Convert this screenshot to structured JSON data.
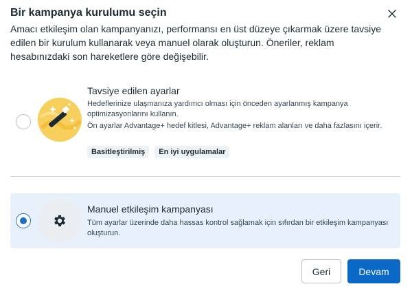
{
  "dialog": {
    "title": "Bir kampanya kurulumu seçin",
    "description": "Amacı etkileşim olan kampanyanızı, performansı en üst düzeye çıkarmak üzere tavsiye edilen bir kurulum kullanarak veya manuel olarak oluşturun. Öneriler, reklam hesabınızdaki son hareketlere göre değişebilir.",
    "close_icon": "close-icon"
  },
  "options": [
    {
      "title": "Tavsiye edilen ayarlar",
      "description_1": "Hedeflerinize ulaşmanıza yardımcı olması için önceden ayarlanmış kampanya optimizasyonlarını kullanın.",
      "description_2": "Ön ayarlar Advantage+ hedef kitlesi, Advantage+ reklam alanları ve daha fazlasını içerir.",
      "tags": [
        "Basitleştirilmiş",
        "En iyi uygulamalar"
      ],
      "selected": false,
      "icon": "magic-wand-icon"
    },
    {
      "title": "Manuel etkileşim kampanyası",
      "description": "Tüm ayarlar üzerinde daha hassas kontrol sağlamak için sıfırdan bir etkileşim kampanyası oluşturun.",
      "selected": true,
      "icon": "gear-icon"
    }
  ],
  "footer": {
    "back_label": "Geri",
    "next_label": "Devam"
  },
  "colors": {
    "accent": "#0a69c6",
    "selected_bg": "#e8f1fb",
    "illustration": "#f7cf5d"
  }
}
